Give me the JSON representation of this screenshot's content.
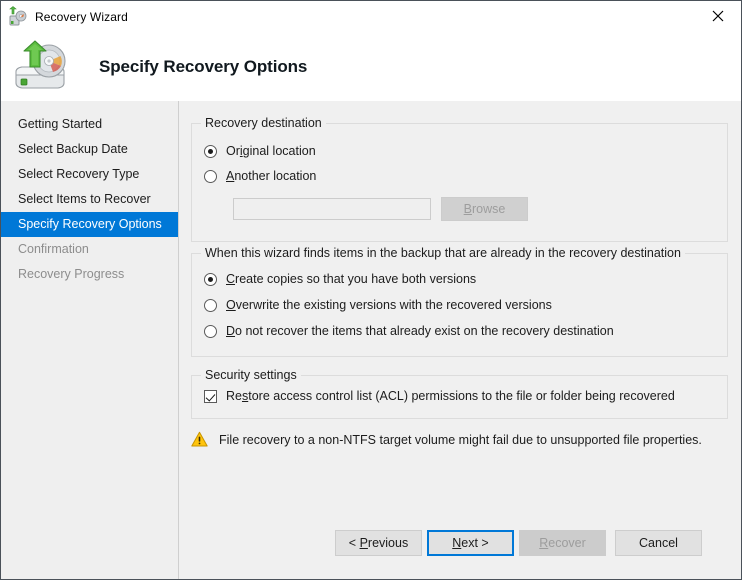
{
  "window": {
    "title": "Recovery Wizard",
    "title_icon": "recovery-wizard-icon",
    "close_icon": "close-icon"
  },
  "header": {
    "icon": "disk-restore-icon",
    "title": "Specify Recovery Options"
  },
  "sidebar": {
    "items": [
      {
        "label": "Getting Started",
        "state": "done"
      },
      {
        "label": "Select Backup Date",
        "state": "done"
      },
      {
        "label": "Select Recovery Type",
        "state": "done"
      },
      {
        "label": "Select Items to Recover",
        "state": "done"
      },
      {
        "label": "Specify Recovery Options",
        "state": "selected"
      },
      {
        "label": "Confirmation",
        "state": "disabled"
      },
      {
        "label": "Recovery Progress",
        "state": "disabled"
      }
    ],
    "selected_bg": "#0078d7",
    "selected_fg": "#ffffff",
    "disabled_fg": "#8d8d8d"
  },
  "destination_group": {
    "legend": "Recovery destination",
    "options": [
      {
        "label": "Original location",
        "accesskey": "i",
        "checked": true
      },
      {
        "label": "Another location",
        "accesskey": "A",
        "checked": false
      }
    ],
    "path_value": "",
    "path_placeholder": "",
    "browse_label": "Browse",
    "browse_accesskey": "B",
    "browse_enabled": false
  },
  "conflicts_group": {
    "legend": "When this wizard finds items in the backup that are already in the recovery destination",
    "options": [
      {
        "label": "Create copies so that you have both versions",
        "accesskey": "C",
        "checked": true
      },
      {
        "label": "Overwrite the existing versions with the recovered versions",
        "accesskey": "O",
        "checked": false
      },
      {
        "label": "Do not recover the items that already exist on the recovery destination",
        "accesskey": "D",
        "checked": false
      }
    ]
  },
  "security_group": {
    "legend": "Security settings",
    "checkbox": {
      "label": "Restore access control list (ACL) permissions to the file or folder being recovered",
      "accesskey": "s",
      "checked": true
    }
  },
  "warning": {
    "icon": "warning-triangle-icon",
    "text": "File recovery to a non-NTFS target volume might fail due to unsupported file properties.",
    "color": "#ffc40c"
  },
  "footer": {
    "buttons": [
      {
        "id": "previous",
        "label": "< Previous",
        "accesskey": "P",
        "enabled": true,
        "focused": false
      },
      {
        "id": "next",
        "label": "Next >",
        "accesskey": "N",
        "enabled": true,
        "focused": true
      },
      {
        "id": "recover",
        "label": "Recover",
        "accesskey": "R",
        "enabled": false,
        "focused": false
      },
      {
        "id": "cancel",
        "label": "Cancel",
        "accesskey": "",
        "enabled": true,
        "focused": false
      }
    ]
  }
}
